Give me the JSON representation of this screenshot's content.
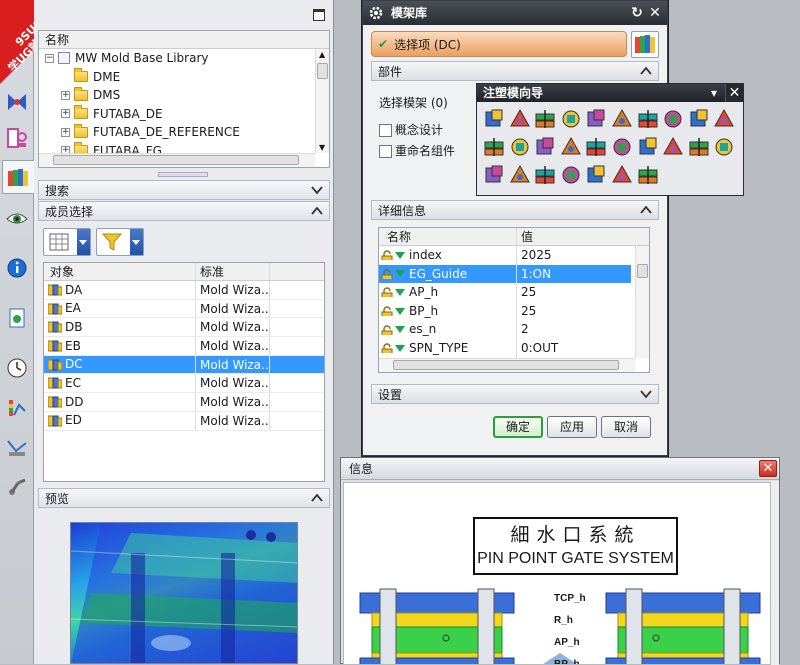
{
  "watermark": {
    "line1": "9SUG",
    "line2": "学UG就上UG网"
  },
  "left_tools": [
    "tool-icon-assembly",
    "tool-icon-constraint",
    "tool-icon-part-tree",
    "tool-icon-library",
    "tool-icon-history",
    "tool-icon-info",
    "tool-icon-roles",
    "tool-icon-clock",
    "tool-icon-analysis",
    "tool-icon-measure",
    "tool-icon-robot"
  ],
  "resource": {
    "tree_header": "名称",
    "tree_items": [
      {
        "label": "MW Mold Base Library",
        "expander": "−",
        "level": 0,
        "icon": "library"
      },
      {
        "label": "DME",
        "expander": "",
        "level": 1,
        "icon": "folder"
      },
      {
        "label": "DMS",
        "expander": "+",
        "level": 1,
        "icon": "folder"
      },
      {
        "label": "FUTABA_DE",
        "expander": "+",
        "level": 1,
        "icon": "folder"
      },
      {
        "label": "FUTABA_DE_REFERENCE",
        "expander": "+",
        "level": 1,
        "icon": "folder"
      },
      {
        "label": "FUTABA_FG",
        "expander": "+",
        "level": 1,
        "icon": "folder"
      }
    ],
    "search_label": "搜索",
    "member_label": "成员选择",
    "member_columns": [
      "对象",
      "标准"
    ],
    "members": [
      {
        "name": "DA",
        "standard": "Mold Wiza..."
      },
      {
        "name": "EA",
        "standard": "Mold Wiza..."
      },
      {
        "name": "DB",
        "standard": "Mold Wiza..."
      },
      {
        "name": "EB",
        "standard": "Mold Wiza..."
      },
      {
        "name": "DC",
        "standard": "Mold Wiza...",
        "selected": true
      },
      {
        "name": "EC",
        "standard": "Mold Wiza..."
      },
      {
        "name": "DD",
        "standard": "Mold Wiza..."
      },
      {
        "name": "ED",
        "standard": "Mold Wiza..."
      }
    ],
    "preview_label": "预览"
  },
  "dialog": {
    "title": "模架库",
    "selection": "选择项 (DC)",
    "parts_label": "部件",
    "select_model": "选择模架 (0)",
    "concept_design": "概念设计",
    "rename_component": "重命名组件",
    "details_label": "详细信息",
    "columns": [
      "名称",
      "值"
    ],
    "attributes": [
      {
        "name": "index",
        "value": "2025"
      },
      {
        "name": "EG_Guide",
        "value": "1:ON",
        "selected": true
      },
      {
        "name": "AP_h",
        "value": "25"
      },
      {
        "name": "BP_h",
        "value": "25"
      },
      {
        "name": "es_n",
        "value": "2"
      },
      {
        "name": "SPN_TYPE",
        "value": "0:OUT"
      }
    ],
    "settings_label": "设置",
    "ok": "确定",
    "apply": "应用",
    "cancel": "取消"
  },
  "flybar": {
    "title": "注塑模向导",
    "menu_glyph": "▾",
    "icons": [
      "initialize-project-icon",
      "mold-csys-icon",
      "shrinkage-icon",
      "workpiece-icon",
      "cavity-layout-icon",
      "parting-icon",
      "mold-base-icon",
      "standard-part-icon",
      "ejector-pin-icon",
      "ejector-trim-icon",
      "slider-icon",
      "subinsert-icon",
      "gate-icon",
      "runner-icon",
      "cooling-icon",
      "electrode-icon",
      "trim-icon",
      "pocket-icon",
      "bom-icon",
      "drawing-icon",
      "casting-process-icon",
      "overflow-icon",
      "hole-table-icon",
      "view-manager-icon",
      "view-icon",
      "delete-files-icon",
      "document-icon"
    ]
  },
  "info": {
    "title": "信息",
    "heading_cn": "細水口系統",
    "heading_en": "PIN POINT GATE SYSTEM",
    "plate_labels": [
      "TCP_h",
      "R_h",
      "AP_h",
      "BP_h"
    ]
  },
  "colors": {
    "selection": "#3399ff",
    "accent_orange": "#eb9f5e",
    "ok_green": "#2f9d3a",
    "close_red": "#c8301e"
  }
}
